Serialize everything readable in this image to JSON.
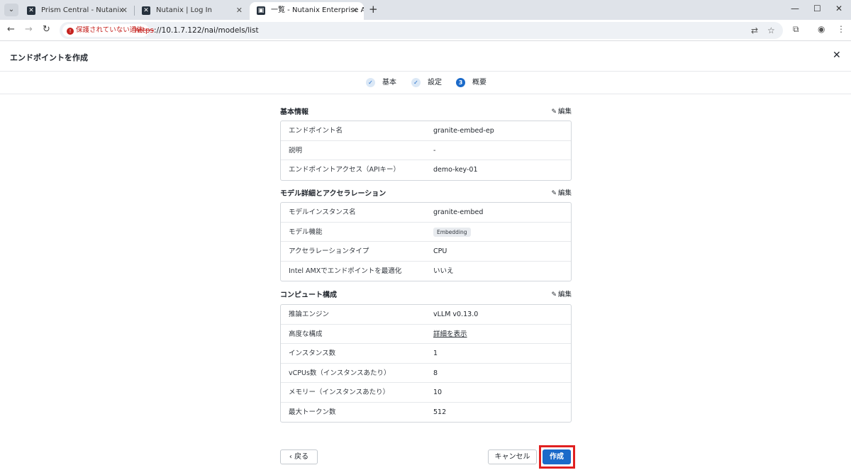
{
  "browser": {
    "tabs": [
      {
        "title": "Prism Central - Nutanix",
        "active": false
      },
      {
        "title": "Nutanix | Log In",
        "active": false
      },
      {
        "title": "一覧 - Nutanix Enterprise AI",
        "active": true
      }
    ],
    "security_label": "保護されていない通信",
    "url_scheme": "https",
    "url_rest": "://10.1.7.122/nai/models/list"
  },
  "modal": {
    "title": "エンドポイントを作成"
  },
  "stepper": {
    "steps": [
      {
        "label": "基本",
        "state": "done",
        "marker": "✓"
      },
      {
        "label": "設定",
        "state": "done",
        "marker": "✓"
      },
      {
        "label": "概要",
        "state": "current",
        "marker": "3"
      }
    ]
  },
  "sections": [
    {
      "title": "基本情報",
      "edit_label": "編集",
      "rows": [
        {
          "label": "エンドポイント名",
          "value": "granite-embed-ep"
        },
        {
          "label": "説明",
          "value": "-"
        },
        {
          "label": "エンドポイントアクセス（APIキー）",
          "value": "demo-key-01"
        }
      ]
    },
    {
      "title": "モデル詳細とアクセラレーション",
      "edit_label": "編集",
      "rows": [
        {
          "label": "モデルインスタンス名",
          "value": "granite-embed"
        },
        {
          "label": "モデル機能",
          "value": "Embedding"
        },
        {
          "label": "アクセラレーションタイプ",
          "value": "CPU"
        },
        {
          "label": "Intel AMXでエンドポイントを最適化",
          "value": "いいえ"
        }
      ]
    },
    {
      "title": "コンピュート構成",
      "edit_label": "編集",
      "rows": [
        {
          "label": "推論エンジン",
          "value": "vLLM v0.13.0"
        },
        {
          "label": "高度な構成",
          "value": "詳細を表示"
        },
        {
          "label": "インスタンス数",
          "value": "1"
        },
        {
          "label": "vCPUs数（インスタンスあたり）",
          "value": "8"
        },
        {
          "label": "メモリー（インスタンスあたり）",
          "value": "10"
        },
        {
          "label": "最大トークン数",
          "value": "512"
        }
      ]
    }
  ],
  "footer": {
    "back_label": "戻る",
    "cancel_label": "キャンセル",
    "create_label": "作成"
  },
  "colors": {
    "primary": "#1b6ac9",
    "highlight": "#e02020",
    "insecure": "#c5221f"
  }
}
